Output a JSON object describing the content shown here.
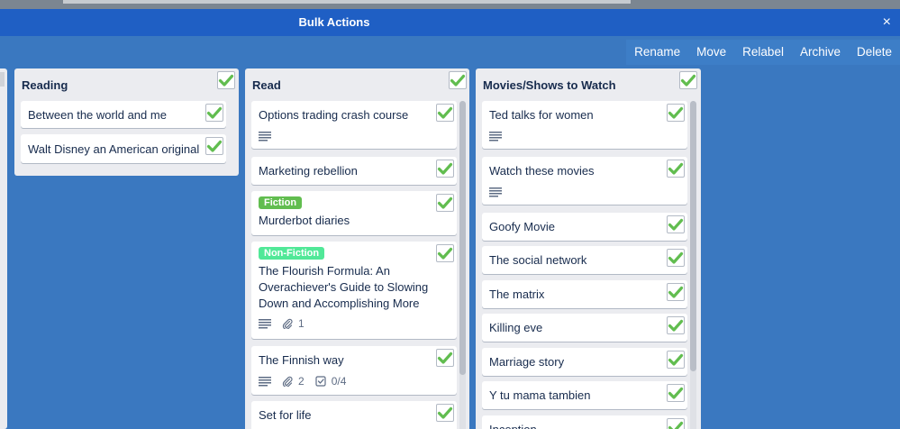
{
  "header": {
    "title": "Bulk Actions",
    "close_icon": "×"
  },
  "actions": {
    "rename": "Rename",
    "move": "Move",
    "relabel": "Relabel",
    "archive": "Archive",
    "delete": "Delete"
  },
  "colors": {
    "check": "#61bd4f",
    "fiction": "#61bd4f",
    "non_fiction": "#51e898",
    "bar": "#1f5fc4",
    "board": "#3a78c0"
  },
  "lists": {
    "reading": {
      "title": "Reading",
      "cards": [
        {
          "title": "Between the world and me"
        },
        {
          "title": "Walt Disney an American original"
        }
      ]
    },
    "read": {
      "title": "Read",
      "cards": [
        {
          "title": "Options trading crash course"
        },
        {
          "title": "Marketing rebellion"
        },
        {
          "label": "Fiction",
          "title": "Murderbot diaries"
        },
        {
          "label": "Non-Fiction",
          "title": "The Flourish Formula: An Overachiever's Guide to Slowing Down and Accomplishing More",
          "attachments": "1"
        },
        {
          "title": "The Finnish way",
          "attachments": "2",
          "checklist": "0/4"
        },
        {
          "title": "Set for life"
        }
      ]
    },
    "movies": {
      "title": "Movies/Shows to Watch",
      "cards": [
        {
          "title": "Ted talks for women"
        },
        {
          "title": "Watch these movies"
        },
        {
          "title": "Goofy Movie"
        },
        {
          "title": "The social network"
        },
        {
          "title": "The matrix"
        },
        {
          "title": "Killing eve"
        },
        {
          "title": "Marriage story"
        },
        {
          "title": "Y tu mama tambien"
        },
        {
          "title": "Inception"
        }
      ]
    }
  }
}
